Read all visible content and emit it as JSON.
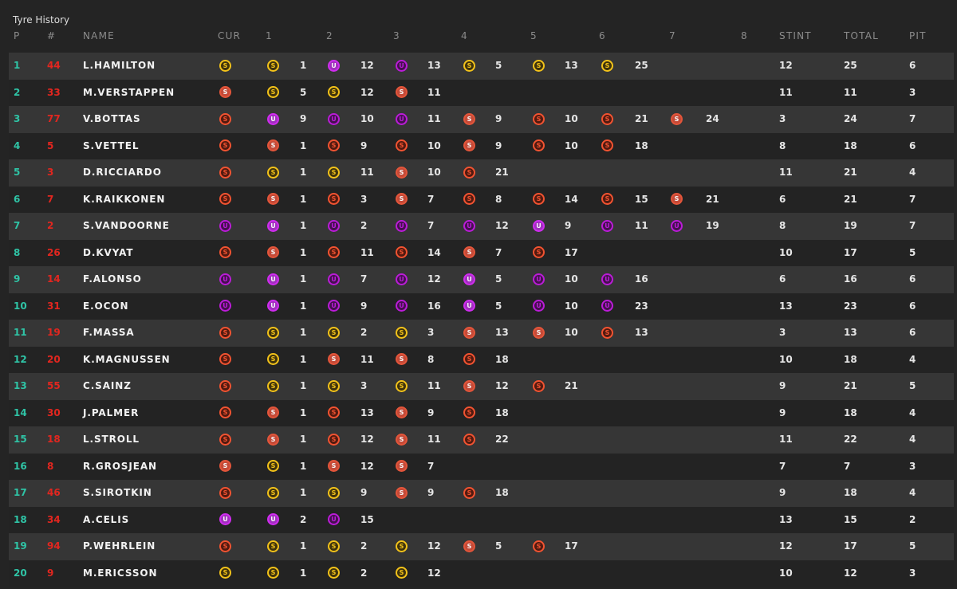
{
  "title": "Tyre History",
  "headers": {
    "p": "P",
    "num": "#",
    "name": "NAME",
    "cur": "CUR",
    "stints": [
      "1",
      "2",
      "3",
      "4",
      "5",
      "6",
      "7",
      "8"
    ],
    "stint": "STINT",
    "total": "TOTAL",
    "pit": "PIT"
  },
  "tyre_letters": {
    "soft": "S",
    "ultra": "U",
    "super": "S"
  },
  "colors": {
    "position": "#2fc4a6",
    "car_number": "#e2261f",
    "supersoft": "#f25331",
    "ultrasoft": "#bb1cd8",
    "soft": "#f2c21a"
  },
  "rows": [
    {
      "p": "1",
      "num": "44",
      "name": "L.HAMILTON",
      "cur": "Y",
      "stints": [
        [
          "Y",
          "1"
        ],
        [
          "UU",
          "12"
        ],
        [
          "US",
          "13"
        ],
        [
          "Y",
          "5"
        ],
        [
          "Y",
          "13"
        ],
        [
          "Y",
          "25"
        ]
      ],
      "stint": "12",
      "total": "25",
      "pit": "6"
    },
    {
      "p": "2",
      "num": "33",
      "name": "M.VERSTAPPEN",
      "cur": "SS",
      "stints": [
        [
          "Y",
          "5"
        ],
        [
          "Y",
          "12"
        ],
        [
          "SS",
          "11"
        ]
      ],
      "stint": "11",
      "total": "11",
      "pit": "3"
    },
    {
      "p": "3",
      "num": "77",
      "name": "V.BOTTAS",
      "cur": "S",
      "stints": [
        [
          "UU",
          "9"
        ],
        [
          "US",
          "10"
        ],
        [
          "US",
          "11"
        ],
        [
          "SS",
          "9"
        ],
        [
          "S",
          "10"
        ],
        [
          "S",
          "21"
        ],
        [
          "SS",
          "24"
        ]
      ],
      "stint": "3",
      "total": "24",
      "pit": "7"
    },
    {
      "p": "4",
      "num": "5",
      "name": "S.VETTEL",
      "cur": "S",
      "stints": [
        [
          "SS",
          "1"
        ],
        [
          "S",
          "9"
        ],
        [
          "S",
          "10"
        ],
        [
          "SS",
          "9"
        ],
        [
          "S",
          "10"
        ],
        [
          "S",
          "18"
        ]
      ],
      "stint": "8",
      "total": "18",
      "pit": "6"
    },
    {
      "p": "5",
      "num": "3",
      "name": "D.RICCIARDO",
      "cur": "S",
      "stints": [
        [
          "Y",
          "1"
        ],
        [
          "Y",
          "11"
        ],
        [
          "SS",
          "10"
        ],
        [
          "S",
          "21"
        ]
      ],
      "stint": "11",
      "total": "21",
      "pit": "4"
    },
    {
      "p": "6",
      "num": "7",
      "name": "K.RAIKKONEN",
      "cur": "S",
      "stints": [
        [
          "SS",
          "1"
        ],
        [
          "S",
          "3"
        ],
        [
          "SS",
          "7"
        ],
        [
          "S",
          "8"
        ],
        [
          "S",
          "14"
        ],
        [
          "S",
          "15"
        ],
        [
          "SS",
          "21"
        ]
      ],
      "stint": "6",
      "total": "21",
      "pit": "7"
    },
    {
      "p": "7",
      "num": "2",
      "name": "S.VANDOORNE",
      "cur": "US",
      "stints": [
        [
          "UU",
          "1"
        ],
        [
          "US",
          "2"
        ],
        [
          "US",
          "7"
        ],
        [
          "US",
          "12"
        ],
        [
          "UU",
          "9"
        ],
        [
          "US",
          "11"
        ],
        [
          "US",
          "19"
        ]
      ],
      "stint": "8",
      "total": "19",
      "pit": "7"
    },
    {
      "p": "8",
      "num": "26",
      "name": "D.KVYAT",
      "cur": "S",
      "stints": [
        [
          "SS",
          "1"
        ],
        [
          "S",
          "11"
        ],
        [
          "S",
          "14"
        ],
        [
          "SS",
          "7"
        ],
        [
          "S",
          "17"
        ]
      ],
      "stint": "10",
      "total": "17",
      "pit": "5"
    },
    {
      "p": "9",
      "num": "14",
      "name": "F.ALONSO",
      "cur": "US",
      "stints": [
        [
          "UU",
          "1"
        ],
        [
          "US",
          "7"
        ],
        [
          "US",
          "12"
        ],
        [
          "UU",
          "5"
        ],
        [
          "US",
          "10"
        ],
        [
          "US",
          "16"
        ]
      ],
      "stint": "6",
      "total": "16",
      "pit": "6"
    },
    {
      "p": "10",
      "num": "31",
      "name": "E.OCON",
      "cur": "US",
      "stints": [
        [
          "UU",
          "1"
        ],
        [
          "US",
          "9"
        ],
        [
          "US",
          "16"
        ],
        [
          "UU",
          "5"
        ],
        [
          "US",
          "10"
        ],
        [
          "US",
          "23"
        ]
      ],
      "stint": "13",
      "total": "23",
      "pit": "6"
    },
    {
      "p": "11",
      "num": "19",
      "name": "F.MASSA",
      "cur": "S",
      "stints": [
        [
          "Y",
          "1"
        ],
        [
          "Y",
          "2"
        ],
        [
          "Y",
          "3"
        ],
        [
          "SS",
          "13"
        ],
        [
          "SS",
          "10"
        ],
        [
          "S",
          "13"
        ]
      ],
      "stint": "3",
      "total": "13",
      "pit": "6"
    },
    {
      "p": "12",
      "num": "20",
      "name": "K.MAGNUSSEN",
      "cur": "S",
      "stints": [
        [
          "Y",
          "1"
        ],
        [
          "SS",
          "11"
        ],
        [
          "SS",
          "8"
        ],
        [
          "S",
          "18"
        ]
      ],
      "stint": "10",
      "total": "18",
      "pit": "4"
    },
    {
      "p": "13",
      "num": "55",
      "name": "C.SAINZ",
      "cur": "S",
      "stints": [
        [
          "Y",
          "1"
        ],
        [
          "Y",
          "3"
        ],
        [
          "Y",
          "11"
        ],
        [
          "SS",
          "12"
        ],
        [
          "S",
          "21"
        ]
      ],
      "stint": "9",
      "total": "21",
      "pit": "5"
    },
    {
      "p": "14",
      "num": "30",
      "name": "J.PALMER",
      "cur": "S",
      "stints": [
        [
          "SS",
          "1"
        ],
        [
          "S",
          "13"
        ],
        [
          "SS",
          "9"
        ],
        [
          "S",
          "18"
        ]
      ],
      "stint": "9",
      "total": "18",
      "pit": "4"
    },
    {
      "p": "15",
      "num": "18",
      "name": "L.STROLL",
      "cur": "S",
      "stints": [
        [
          "SS",
          "1"
        ],
        [
          "S",
          "12"
        ],
        [
          "SS",
          "11"
        ],
        [
          "S",
          "22"
        ]
      ],
      "stint": "11",
      "total": "22",
      "pit": "4"
    },
    {
      "p": "16",
      "num": "8",
      "name": "R.GROSJEAN",
      "cur": "SS",
      "stints": [
        [
          "Y",
          "1"
        ],
        [
          "SS",
          "12"
        ],
        [
          "SS",
          "7"
        ]
      ],
      "stint": "7",
      "total": "7",
      "pit": "3"
    },
    {
      "p": "17",
      "num": "46",
      "name": "S.SIROTKIN",
      "cur": "S",
      "stints": [
        [
          "Y",
          "1"
        ],
        [
          "Y",
          "9"
        ],
        [
          "SS",
          "9"
        ],
        [
          "S",
          "18"
        ]
      ],
      "stint": "9",
      "total": "18",
      "pit": "4"
    },
    {
      "p": "18",
      "num": "34",
      "name": "A.CELIS",
      "cur": "UU",
      "stints": [
        [
          "UU",
          "2"
        ],
        [
          "US",
          "15"
        ]
      ],
      "stint": "13",
      "total": "15",
      "pit": "2"
    },
    {
      "p": "19",
      "num": "94",
      "name": "P.WEHRLEIN",
      "cur": "S",
      "stints": [
        [
          "Y",
          "1"
        ],
        [
          "Y",
          "2"
        ],
        [
          "Y",
          "12"
        ],
        [
          "SS",
          "5"
        ],
        [
          "S",
          "17"
        ]
      ],
      "stint": "12",
      "total": "17",
      "pit": "5"
    },
    {
      "p": "20",
      "num": "9",
      "name": "M.ERICSSON",
      "cur": "Y",
      "stints": [
        [
          "Y",
          "1"
        ],
        [
          "Y",
          "2"
        ],
        [
          "Y",
          "12"
        ]
      ],
      "stint": "10",
      "total": "12",
      "pit": "3"
    }
  ]
}
